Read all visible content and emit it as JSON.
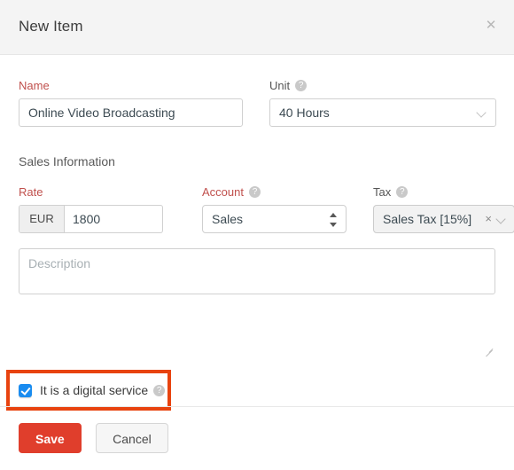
{
  "header": {
    "title": "New Item",
    "close_icon": "close-icon"
  },
  "form": {
    "name": {
      "label": "Name",
      "value": "Online Video Broadcasting",
      "placeholder": ""
    },
    "unit": {
      "label": "Unit",
      "help_icon": "help-icon",
      "value": "40 Hours",
      "chevron_icon": "chevron-down-icon"
    },
    "section_title": "Sales Information",
    "rate": {
      "label": "Rate",
      "currency": "EUR",
      "value": "1800",
      "placeholder": ""
    },
    "account": {
      "label": "Account",
      "help_icon": "help-icon",
      "value": "Sales",
      "spinner_icon": "select-arrows-icon"
    },
    "tax": {
      "label": "Tax",
      "help_icon": "help-icon",
      "value": "Sales Tax [15%]",
      "clear_icon": "×",
      "chevron_icon": "chevron-down-icon"
    },
    "description": {
      "placeholder": "Description",
      "value": ""
    },
    "digital_service": {
      "label": "It is a digital service",
      "checked": true,
      "help_icon": "help-icon"
    }
  },
  "footer": {
    "save_label": "Save",
    "cancel_label": "Cancel"
  },
  "colors": {
    "accent_red": "#e03e2c",
    "highlight": "#e8430f",
    "required_label": "#c0504d",
    "checkbox_blue": "#1a8cf0",
    "header_bg": "#f4f4f4"
  }
}
